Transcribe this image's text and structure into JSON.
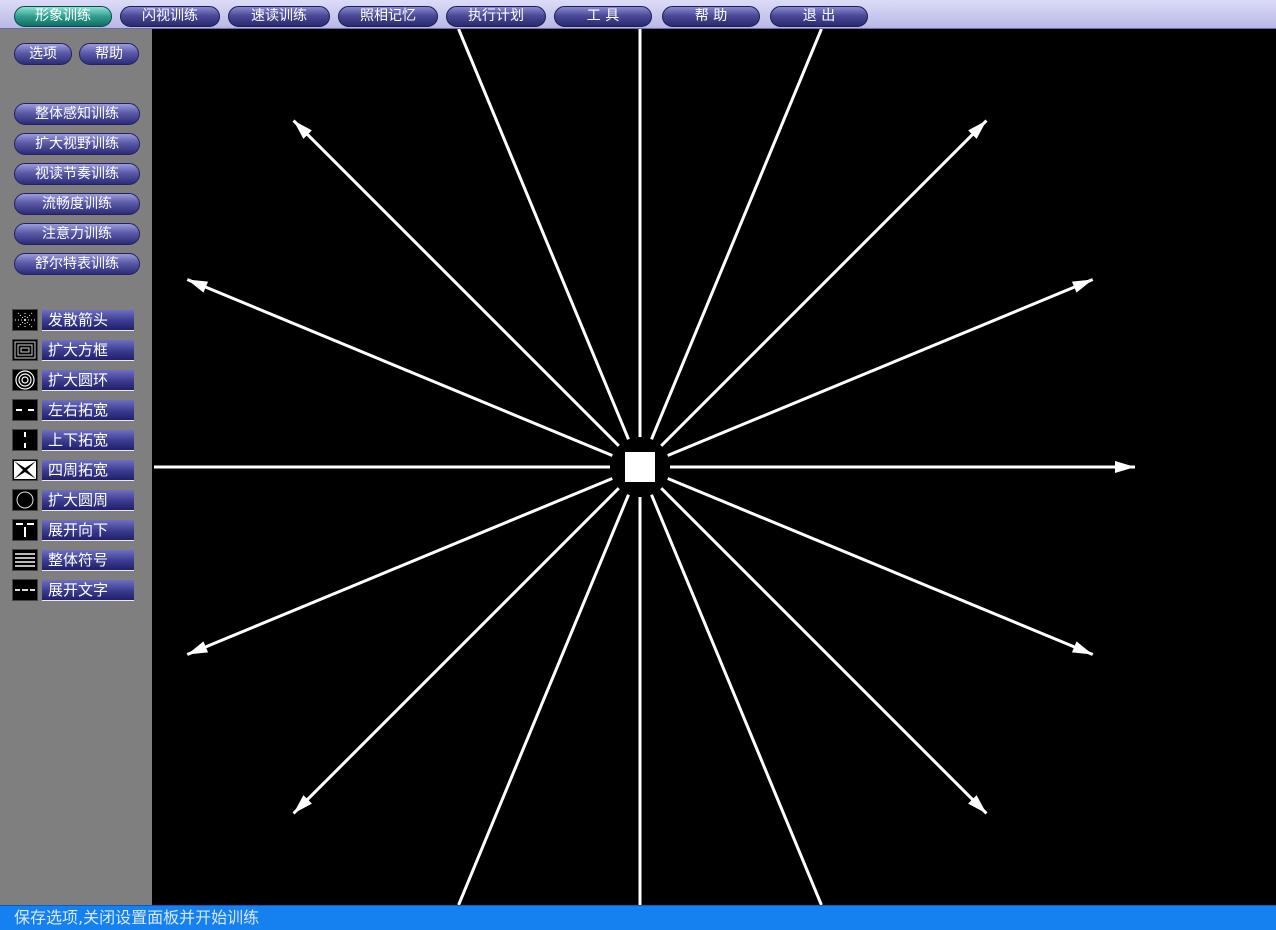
{
  "menubar": {
    "items": [
      {
        "label": "形象训练",
        "active": true
      },
      {
        "label": "闪视训练"
      },
      {
        "label": "速读训练"
      },
      {
        "label": "照相记忆"
      },
      {
        "label": "执行计划"
      },
      {
        "label": "工 具"
      },
      {
        "label": "帮 助"
      },
      {
        "label": "退 出"
      }
    ]
  },
  "sidebar": {
    "options_label": "选项",
    "help_label": "帮助",
    "categories": [
      {
        "label": "整体感知训练"
      },
      {
        "label": "扩大视野训练"
      },
      {
        "label": "视读节奏训练"
      },
      {
        "label": "流畅度训练"
      },
      {
        "label": "注意力训练"
      },
      {
        "label": "舒尔特表训练"
      }
    ],
    "tools": [
      {
        "label": "发散箭头",
        "icon": "diverging-arrows-icon"
      },
      {
        "label": "扩大方框",
        "icon": "expanding-squares-icon"
      },
      {
        "label": "扩大圆环",
        "icon": "expanding-rings-icon"
      },
      {
        "label": "左右拓宽",
        "icon": "horizontal-expand-icon"
      },
      {
        "label": "上下拓宽",
        "icon": "vertical-expand-icon"
      },
      {
        "label": "四周拓宽",
        "icon": "four-way-expand-icon"
      },
      {
        "label": "扩大圆周",
        "icon": "expanding-circle-icon"
      },
      {
        "label": "展开向下",
        "icon": "expand-down-icon"
      },
      {
        "label": "整体符号",
        "icon": "symbol-grid-icon"
      },
      {
        "label": "展开文字",
        "icon": "text-expand-icon"
      }
    ]
  },
  "statusbar": {
    "text": "保存选项,关闭设置面板并开始训练"
  },
  "colors": {
    "canvas_bg": "#000000",
    "arrow_color": "#ffffff",
    "sidebar_bg": "#7f7f7f",
    "status_bg": "#1580f0",
    "active_menu": "#2f9e90",
    "menu_button": "#4a4a98"
  },
  "canvas": {
    "exercise": "diverging-arrows",
    "arrow_count": 16
  }
}
